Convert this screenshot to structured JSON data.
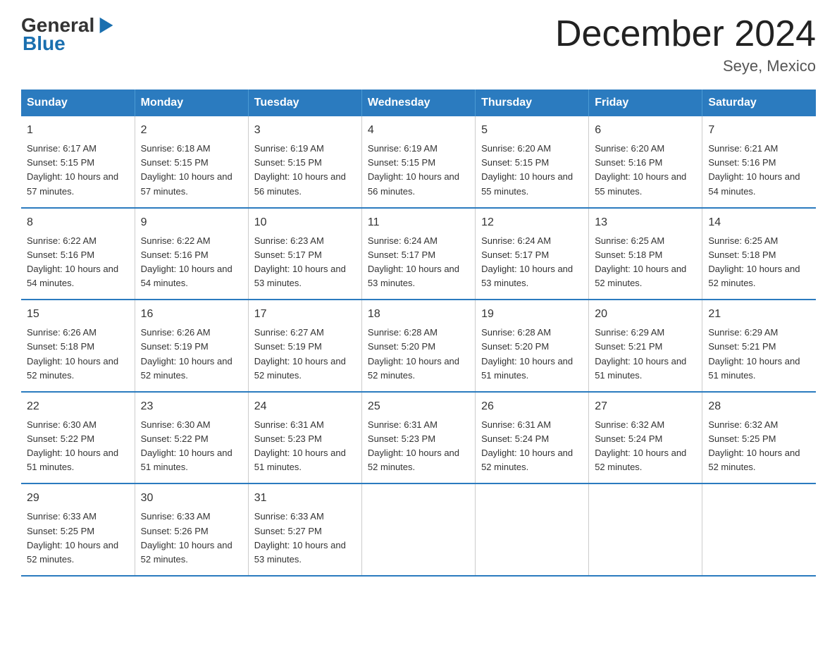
{
  "header": {
    "logo_general": "General",
    "logo_arrow": "▶",
    "logo_blue": "Blue",
    "title": "December 2024",
    "subtitle": "Seye, Mexico"
  },
  "days_of_week": [
    "Sunday",
    "Monday",
    "Tuesday",
    "Wednesday",
    "Thursday",
    "Friday",
    "Saturday"
  ],
  "weeks": [
    [
      {
        "num": "1",
        "sunrise": "6:17 AM",
        "sunset": "5:15 PM",
        "daylight": "10 hours and 57 minutes."
      },
      {
        "num": "2",
        "sunrise": "6:18 AM",
        "sunset": "5:15 PM",
        "daylight": "10 hours and 57 minutes."
      },
      {
        "num": "3",
        "sunrise": "6:19 AM",
        "sunset": "5:15 PM",
        "daylight": "10 hours and 56 minutes."
      },
      {
        "num": "4",
        "sunrise": "6:19 AM",
        "sunset": "5:15 PM",
        "daylight": "10 hours and 56 minutes."
      },
      {
        "num": "5",
        "sunrise": "6:20 AM",
        "sunset": "5:15 PM",
        "daylight": "10 hours and 55 minutes."
      },
      {
        "num": "6",
        "sunrise": "6:20 AM",
        "sunset": "5:16 PM",
        "daylight": "10 hours and 55 minutes."
      },
      {
        "num": "7",
        "sunrise": "6:21 AM",
        "sunset": "5:16 PM",
        "daylight": "10 hours and 54 minutes."
      }
    ],
    [
      {
        "num": "8",
        "sunrise": "6:22 AM",
        "sunset": "5:16 PM",
        "daylight": "10 hours and 54 minutes."
      },
      {
        "num": "9",
        "sunrise": "6:22 AM",
        "sunset": "5:16 PM",
        "daylight": "10 hours and 54 minutes."
      },
      {
        "num": "10",
        "sunrise": "6:23 AM",
        "sunset": "5:17 PM",
        "daylight": "10 hours and 53 minutes."
      },
      {
        "num": "11",
        "sunrise": "6:24 AM",
        "sunset": "5:17 PM",
        "daylight": "10 hours and 53 minutes."
      },
      {
        "num": "12",
        "sunrise": "6:24 AM",
        "sunset": "5:17 PM",
        "daylight": "10 hours and 53 minutes."
      },
      {
        "num": "13",
        "sunrise": "6:25 AM",
        "sunset": "5:18 PM",
        "daylight": "10 hours and 52 minutes."
      },
      {
        "num": "14",
        "sunrise": "6:25 AM",
        "sunset": "5:18 PM",
        "daylight": "10 hours and 52 minutes."
      }
    ],
    [
      {
        "num": "15",
        "sunrise": "6:26 AM",
        "sunset": "5:18 PM",
        "daylight": "10 hours and 52 minutes."
      },
      {
        "num": "16",
        "sunrise": "6:26 AM",
        "sunset": "5:19 PM",
        "daylight": "10 hours and 52 minutes."
      },
      {
        "num": "17",
        "sunrise": "6:27 AM",
        "sunset": "5:19 PM",
        "daylight": "10 hours and 52 minutes."
      },
      {
        "num": "18",
        "sunrise": "6:28 AM",
        "sunset": "5:20 PM",
        "daylight": "10 hours and 52 minutes."
      },
      {
        "num": "19",
        "sunrise": "6:28 AM",
        "sunset": "5:20 PM",
        "daylight": "10 hours and 51 minutes."
      },
      {
        "num": "20",
        "sunrise": "6:29 AM",
        "sunset": "5:21 PM",
        "daylight": "10 hours and 51 minutes."
      },
      {
        "num": "21",
        "sunrise": "6:29 AM",
        "sunset": "5:21 PM",
        "daylight": "10 hours and 51 minutes."
      }
    ],
    [
      {
        "num": "22",
        "sunrise": "6:30 AM",
        "sunset": "5:22 PM",
        "daylight": "10 hours and 51 minutes."
      },
      {
        "num": "23",
        "sunrise": "6:30 AM",
        "sunset": "5:22 PM",
        "daylight": "10 hours and 51 minutes."
      },
      {
        "num": "24",
        "sunrise": "6:31 AM",
        "sunset": "5:23 PM",
        "daylight": "10 hours and 51 minutes."
      },
      {
        "num": "25",
        "sunrise": "6:31 AM",
        "sunset": "5:23 PM",
        "daylight": "10 hours and 52 minutes."
      },
      {
        "num": "26",
        "sunrise": "6:31 AM",
        "sunset": "5:24 PM",
        "daylight": "10 hours and 52 minutes."
      },
      {
        "num": "27",
        "sunrise": "6:32 AM",
        "sunset": "5:24 PM",
        "daylight": "10 hours and 52 minutes."
      },
      {
        "num": "28",
        "sunrise": "6:32 AM",
        "sunset": "5:25 PM",
        "daylight": "10 hours and 52 minutes."
      }
    ],
    [
      {
        "num": "29",
        "sunrise": "6:33 AM",
        "sunset": "5:25 PM",
        "daylight": "10 hours and 52 minutes."
      },
      {
        "num": "30",
        "sunrise": "6:33 AM",
        "sunset": "5:26 PM",
        "daylight": "10 hours and 52 minutes."
      },
      {
        "num": "31",
        "sunrise": "6:33 AM",
        "sunset": "5:27 PM",
        "daylight": "10 hours and 53 minutes."
      },
      null,
      null,
      null,
      null
    ]
  ],
  "labels": {
    "sunrise": "Sunrise:",
    "sunset": "Sunset:",
    "daylight": "Daylight:"
  }
}
